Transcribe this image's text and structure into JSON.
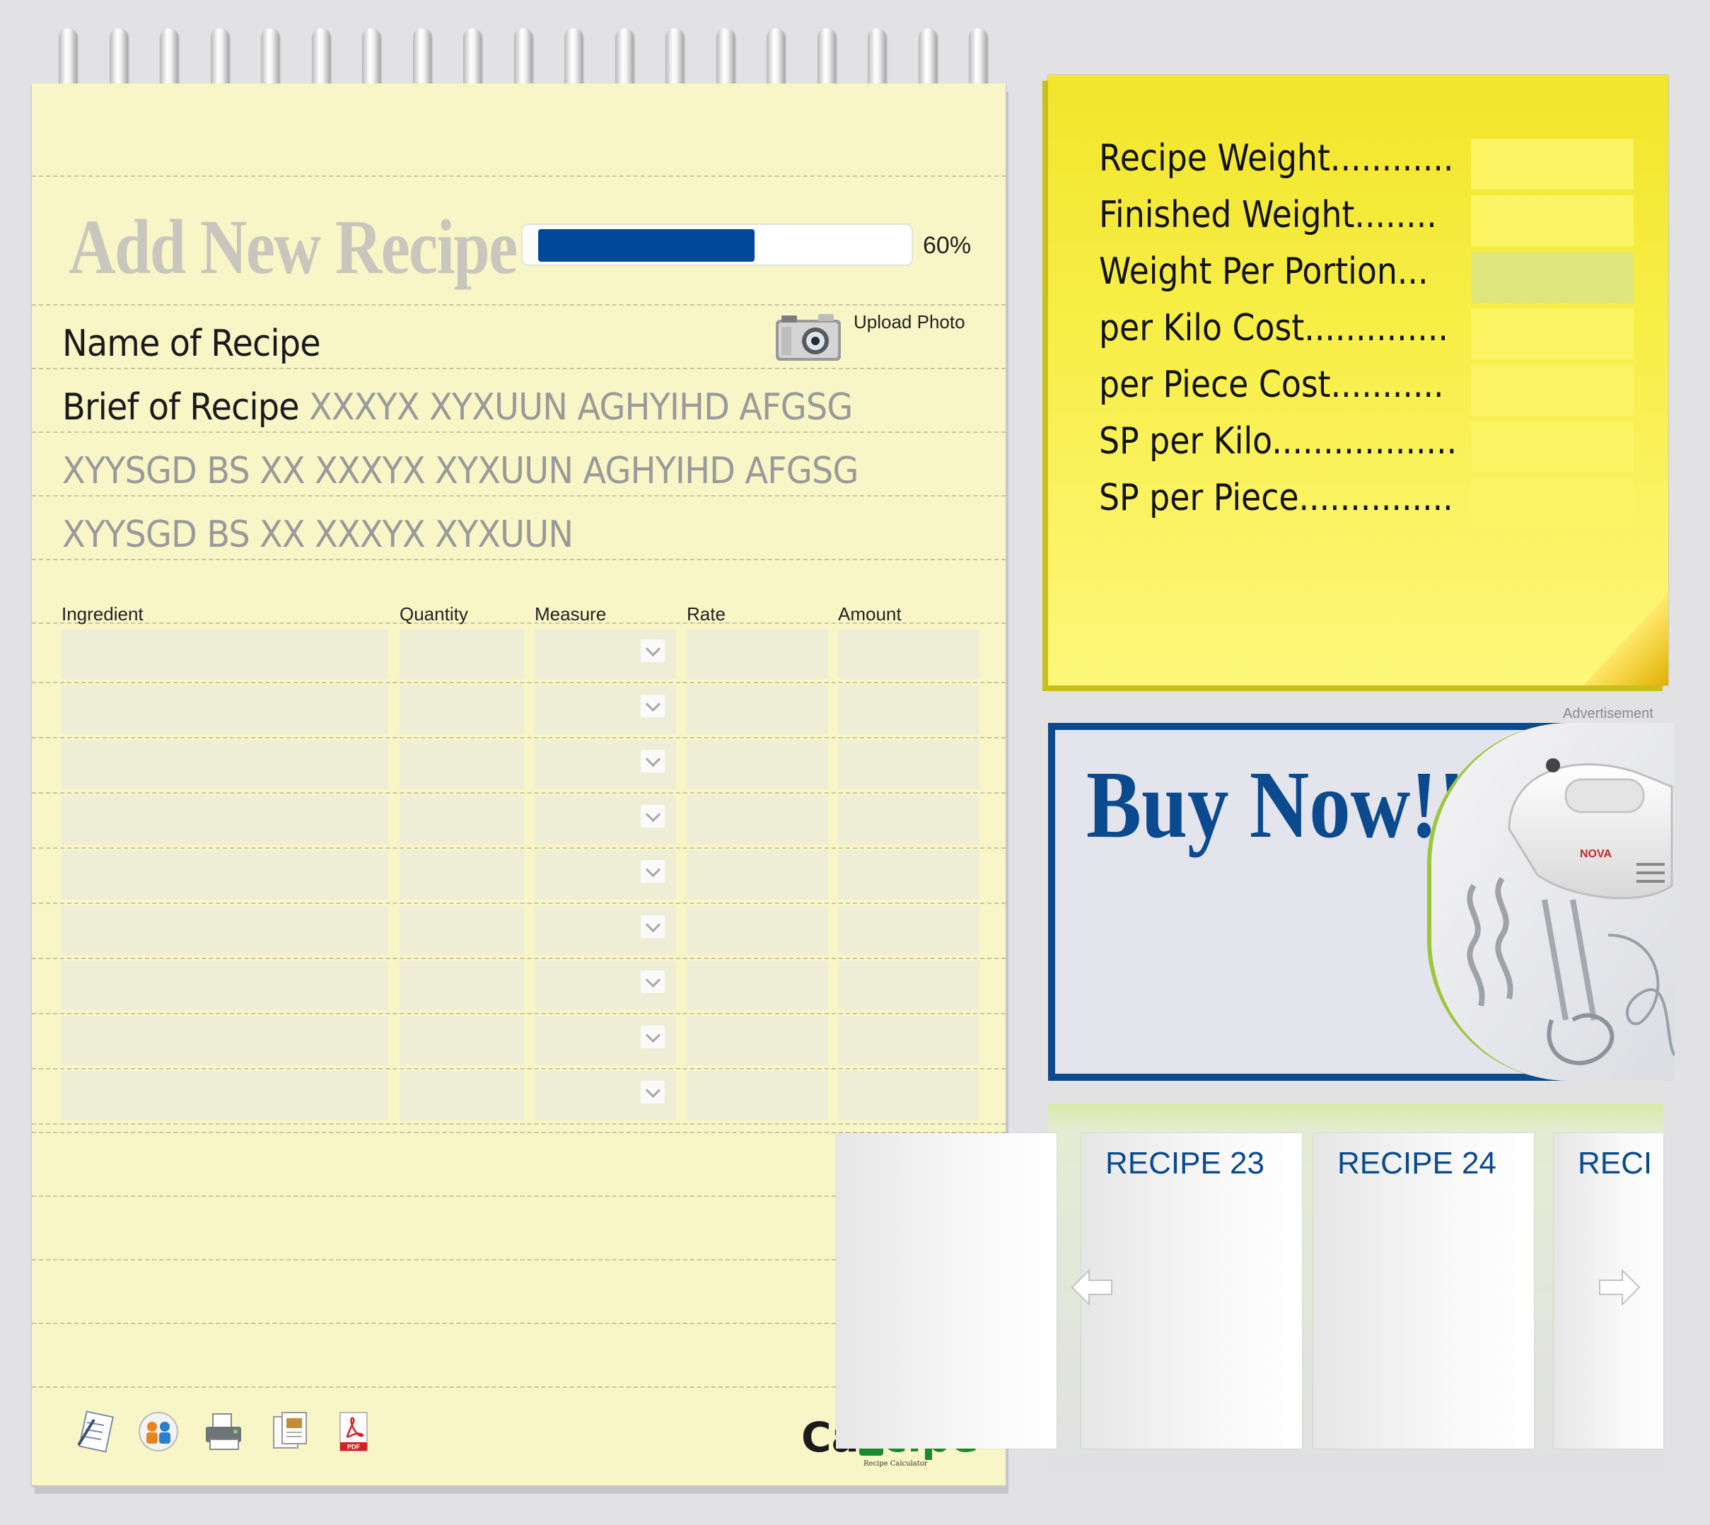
{
  "form": {
    "title": "Add New Recipe",
    "progress_percent": 60,
    "progress_text": "60%",
    "upload_label": "Upload Photo",
    "name_label": "Name of Recipe",
    "brief_label": "Brief of Recipe",
    "brief_lines": [
      "XXXYX  XYXUUN  AGHYIHD AFGSG",
      "XYYSGD BS XX XXXYX  XYXUUN  AGHYIHD AFGSG",
      "XYYSGD BS XX XXXYX  XYXUUN"
    ],
    "columns": [
      "Ingredient",
      "Quantity",
      "Measure",
      "Rate",
      "Amount"
    ],
    "row_count": 9
  },
  "toolbar_icons": [
    "notepad-icon",
    "share-icon",
    "printer-icon",
    "document-icon",
    "pdf-icon"
  ],
  "logo": {
    "part1": "Ca",
    "part2": "cipe",
    "subtitle": "Recipe Calculator"
  },
  "summary": {
    "rows": [
      {
        "label": "Recipe Weight............",
        "value": ""
      },
      {
        "label": "Finished Weight........",
        "value": ""
      },
      {
        "label": "Weight Per Portion...",
        "value": ""
      },
      {
        "label": "per Kilo Cost..............",
        "value": ""
      },
      {
        "label": "per Piece Cost...........",
        "value": ""
      },
      {
        "label": "SP per Kilo..................",
        "value": ""
      },
      {
        "label": "SP per Piece...............",
        "value": ""
      }
    ]
  },
  "ad": {
    "label": "Advertisement",
    "headline": "Buy Now!!",
    "product_brand": "NOVA"
  },
  "carousel": {
    "cards": [
      "RECIPE 23",
      "RECIPE 24",
      "RECI"
    ]
  },
  "colors": {
    "accent_blue": "#00489a",
    "notepad": "#f8f6c6",
    "sticky": "#f7ee46",
    "logo_green": "#1b8a2a"
  }
}
